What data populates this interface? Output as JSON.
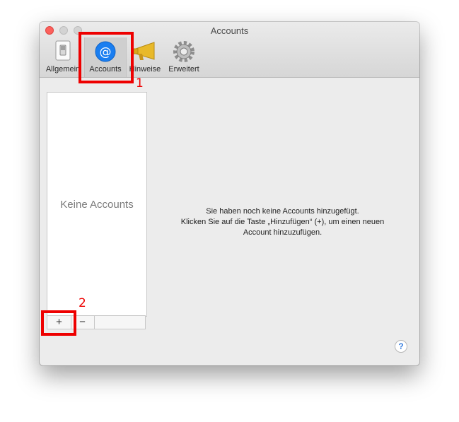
{
  "window": {
    "title": "Accounts"
  },
  "toolbar": {
    "items": [
      {
        "label": "Allgemein",
        "icon": "switch-icon"
      },
      {
        "label": "Accounts",
        "icon": "at-sign-icon",
        "selected": true
      },
      {
        "label": "Hinweise",
        "icon": "megaphone-icon"
      },
      {
        "label": "Erweitert",
        "icon": "gear-icon"
      }
    ]
  },
  "accounts_list": {
    "empty_text": "Keine Accounts",
    "add_label": "+",
    "remove_label": "−"
  },
  "info": {
    "line1": "Sie haben noch keine Accounts hinzugefügt.",
    "line2": "Klicken Sie auf die Taste „Hinzufügen“ (+), um einen neuen",
    "line3": "Account hinzuzufügen."
  },
  "help": {
    "label": "?"
  },
  "annotations": {
    "n1": "1",
    "n2": "2",
    "color": "#ee0000"
  },
  "colors": {
    "accent_blue": "#1a7ef0",
    "close_red": "#fc605c"
  }
}
